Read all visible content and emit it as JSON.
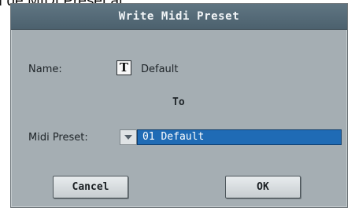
{
  "background_caption": "ı de MIDI Preset al.",
  "dialog": {
    "title": "Write Midi Preset",
    "name_label": "Name:",
    "name_icon": "T",
    "name_value": "Default",
    "to_label": "To",
    "midi_preset_label": "Midi Preset:",
    "midi_preset_value": "01 Default",
    "cancel_label": "Cancel",
    "ok_label": "OK"
  },
  "colors": {
    "titlebar": "#546a77",
    "dialog_body": "#a5aeb3",
    "selected_field": "#1f6bb5"
  }
}
